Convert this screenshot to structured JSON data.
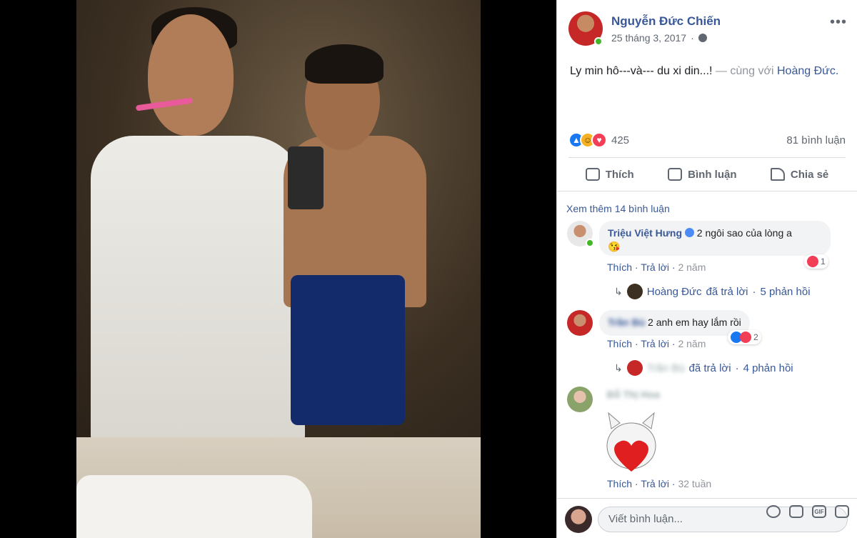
{
  "post": {
    "author": "Nguyễn Đức Chiến",
    "date": "25 tháng 3, 2017",
    "text_main": "Ly min hô---và--- du xi din...!",
    "text_with": " — cùng với ",
    "tagged": "Hoàng Đức",
    "tagged_end": ".",
    "reaction_count": "425",
    "comment_count": "81 bình luận",
    "actions": {
      "like": "Thích",
      "comment": "Bình luận",
      "share": "Chia sẻ"
    }
  },
  "comments": {
    "see_more": "Xem thêm 14 bình luận",
    "items": [
      {
        "name": "Triệu Việt Hưng",
        "text": "2 ngôi sao của lòng a",
        "emoji": "😘",
        "like": "Thích",
        "reply": "Trả lời",
        "time": "2 năm",
        "react_count": "1",
        "replies_by": "Hoàng Đức",
        "replies_verb": "đã trả lời",
        "replies_sep": "·",
        "replies_count": "5 phản hồi"
      },
      {
        "name": "Trần Bù",
        "text": "2 anh em hay lắm rồi",
        "like": "Thích",
        "reply": "Trả lời",
        "time": "2 năm",
        "react_count": "2",
        "replies_by": "Trần Bù",
        "replies_verb": "đã trả lời",
        "replies_sep": "·",
        "replies_count": "4 phản hồi"
      },
      {
        "name": "Đỗ Thị Hoa",
        "like": "Thích",
        "reply": "Trả lời",
        "time": "32 tuần"
      }
    ]
  },
  "composer": {
    "placeholder": "Viết bình luận...",
    "gif": "GIF"
  },
  "colors": {
    "link": "#385898",
    "muted": "#606770",
    "bubble": "#f2f3f5",
    "online": "#42b72a"
  }
}
